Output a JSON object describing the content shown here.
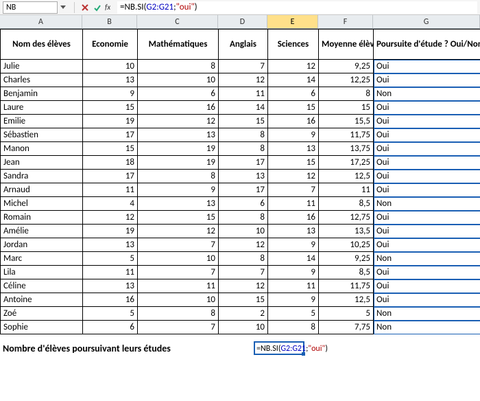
{
  "formula_bar": {
    "name_box": "NB",
    "formula": "=NB.SI(G2:G21;\"oui\")",
    "formula_parts": {
      "prefix": "=NB.SI(",
      "range": "G2:G21",
      "sep": ";",
      "arg": "\"oui\"",
      "suffix": ")"
    }
  },
  "column_letters": [
    "A",
    "B",
    "C",
    "D",
    "E",
    "F",
    "G"
  ],
  "active_column_index": 4,
  "headers": {
    "A": "Nom des élèves",
    "B": "Economie",
    "C": "Mathématiques",
    "D": "Anglais",
    "E": "Sciences",
    "F": "Moyenne élève",
    "G": "Poursuite d'étude ? Oui/Non"
  },
  "rows": [
    {
      "name": "Julie",
      "eco": 10,
      "math": 8,
      "ang": 7,
      "sci": 12,
      "avg": "9,25",
      "pour": "Oui"
    },
    {
      "name": "Charles",
      "eco": 13,
      "math": 10,
      "ang": 12,
      "sci": 14,
      "avg": "12,25",
      "pour": "Oui"
    },
    {
      "name": "Benjamin",
      "eco": 9,
      "math": 6,
      "ang": 11,
      "sci": 6,
      "avg": "8",
      "pour": "Non"
    },
    {
      "name": "Laure",
      "eco": 15,
      "math": 16,
      "ang": 14,
      "sci": 15,
      "avg": "15",
      "pour": "Oui"
    },
    {
      "name": "Emilie",
      "eco": 19,
      "math": 12,
      "ang": 15,
      "sci": 16,
      "avg": "15,5",
      "pour": "Oui"
    },
    {
      "name": "Sébastien",
      "eco": 17,
      "math": 13,
      "ang": 8,
      "sci": 9,
      "avg": "11,75",
      "pour": "Oui"
    },
    {
      "name": "Manon",
      "eco": 15,
      "math": 19,
      "ang": 8,
      "sci": 13,
      "avg": "13,75",
      "pour": "Oui"
    },
    {
      "name": "Jean",
      "eco": 18,
      "math": 19,
      "ang": 17,
      "sci": 15,
      "avg": "17,25",
      "pour": "Oui"
    },
    {
      "name": "Sandra",
      "eco": 17,
      "math": 8,
      "ang": 13,
      "sci": 12,
      "avg": "12,5",
      "pour": "Oui"
    },
    {
      "name": "Arnaud",
      "eco": 11,
      "math": 9,
      "ang": 17,
      "sci": 7,
      "avg": "11",
      "pour": "Oui"
    },
    {
      "name": "Michel",
      "eco": 4,
      "math": 13,
      "ang": 6,
      "sci": 11,
      "avg": "8,5",
      "pour": "Non"
    },
    {
      "name": "Romain",
      "eco": 12,
      "math": 15,
      "ang": 8,
      "sci": 16,
      "avg": "12,75",
      "pour": "Oui"
    },
    {
      "name": "Amélie",
      "eco": 19,
      "math": 12,
      "ang": 10,
      "sci": 13,
      "avg": "13,5",
      "pour": "Oui"
    },
    {
      "name": "Jordan",
      "eco": 13,
      "math": 7,
      "ang": 12,
      "sci": 9,
      "avg": "10,25",
      "pour": "Oui"
    },
    {
      "name": "Marc",
      "eco": 5,
      "math": 10,
      "ang": 8,
      "sci": 14,
      "avg": "9,25",
      "pour": "Non"
    },
    {
      "name": "Lila",
      "eco": 11,
      "math": 7,
      "ang": 7,
      "sci": 9,
      "avg": "8,5",
      "pour": "Oui"
    },
    {
      "name": "Céline",
      "eco": 13,
      "math": 11,
      "ang": 12,
      "sci": 11,
      "avg": "11,75",
      "pour": "Oui"
    },
    {
      "name": "Antoine",
      "eco": 16,
      "math": 10,
      "ang": 15,
      "sci": 9,
      "avg": "12,5",
      "pour": "Oui"
    },
    {
      "name": "Zoé",
      "eco": 5,
      "math": 8,
      "ang": 2,
      "sci": 5,
      "avg": "5",
      "pour": "Non"
    },
    {
      "name": "Sophie",
      "eco": 6,
      "math": 7,
      "ang": 10,
      "sci": 8,
      "avg": "7,75",
      "pour": "Non"
    }
  ],
  "bottom": {
    "label": "Nombre d'élèves poursuivant leurs études",
    "cell_parts": {
      "prefix": "=NB.SI(",
      "range": "G2:G21",
      "sep": ";",
      "arg": "\"oui\"",
      "suffix": ")"
    }
  },
  "icons": {
    "cancel": "cancel-icon",
    "enter": "enter-icon",
    "fx": "fx-icon"
  }
}
